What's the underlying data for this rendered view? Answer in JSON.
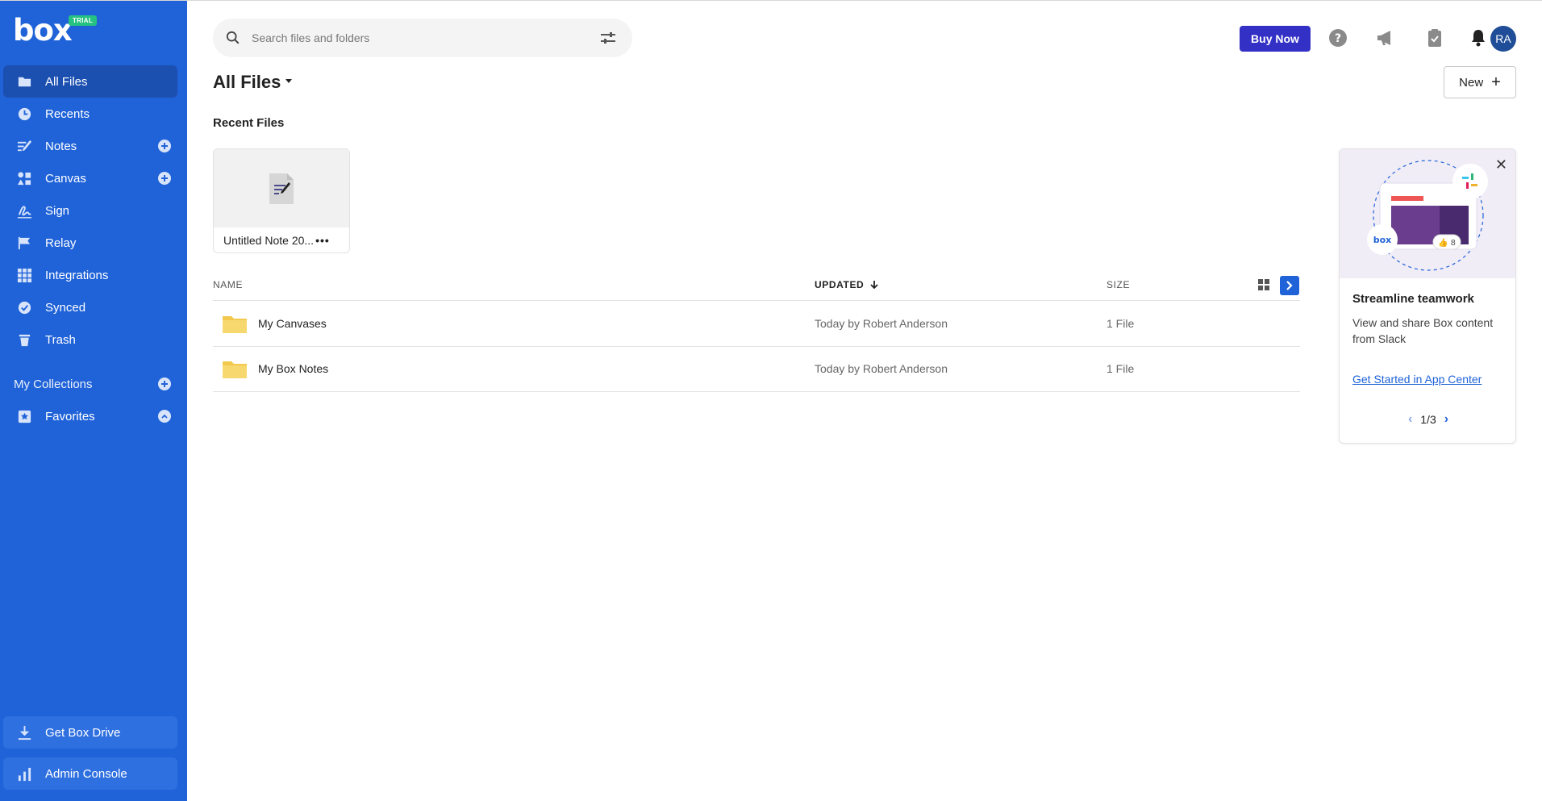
{
  "brand": {
    "logo": "box",
    "badge": "TRIAL"
  },
  "sidebar": {
    "items": [
      {
        "label": "All Files",
        "icon": "folder-icon"
      },
      {
        "label": "Recents",
        "icon": "clock-icon"
      },
      {
        "label": "Notes",
        "icon": "notes-icon"
      },
      {
        "label": "Canvas",
        "icon": "canvas-icon"
      },
      {
        "label": "Sign",
        "icon": "sign-icon"
      },
      {
        "label": "Relay",
        "icon": "relay-icon"
      },
      {
        "label": "Integrations",
        "icon": "grid-icon"
      },
      {
        "label": "Synced",
        "icon": "check-circle-icon"
      },
      {
        "label": "Trash",
        "icon": "trash-icon"
      }
    ],
    "collections_label": "My Collections",
    "favorites_label": "Favorites",
    "get_drive_label": "Get Box Drive",
    "admin_console_label": "Admin Console"
  },
  "header": {
    "search_placeholder": "Search files and folders",
    "buy_now": "Buy Now",
    "avatar_initials": "RA"
  },
  "main": {
    "title": "All Files",
    "new_button": "New",
    "recent_label": "Recent Files",
    "recent_files": [
      {
        "name": "Untitled Note 20...",
        "more": "•••"
      }
    ],
    "columns": {
      "name": "NAME",
      "updated": "UPDATED",
      "size": "SIZE"
    },
    "rows": [
      {
        "name": "My Canvases",
        "updated": "Today by Robert Anderson",
        "size": "1 File"
      },
      {
        "name": "My Box Notes",
        "updated": "Today by Robert Anderson",
        "size": "1 File"
      }
    ]
  },
  "promo": {
    "title": "Streamline teamwork",
    "text": "View and share Box content from Slack",
    "link": "Get Started in App Center",
    "pager": "1/3",
    "image_logo": "box",
    "image_likes": "👍 8"
  },
  "colors": {
    "sidebar": "#2063d8",
    "buy_now": "#3330c6",
    "avatar": "#1f4d97",
    "folder": "#f7d56b"
  }
}
